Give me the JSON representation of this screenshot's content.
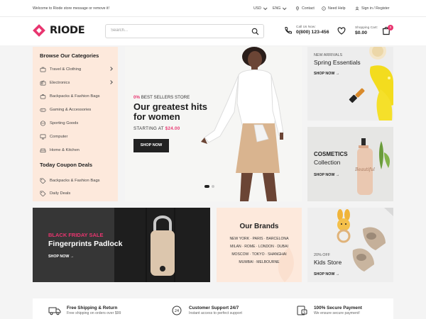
{
  "topbar": {
    "welcome": "Welcome to Riode store message or remove it!",
    "currency": "USD",
    "language": "ENG",
    "contact": "Contact",
    "help": "Need Help",
    "signin": "Sign in / Register"
  },
  "header": {
    "logo": "RIODE",
    "search_placeholder": "Search...",
    "call_label": "Call Us Now:",
    "phone": "0(800) 123-456",
    "cart_label": "Shopping Cart:",
    "cart_total": "$0.00",
    "cart_count": "0"
  },
  "sidebar": {
    "heading": "Browse Our Categories",
    "items": [
      {
        "label": "Travel & Clothing",
        "icon": "suitcase-icon",
        "has_arrow": true
      },
      {
        "label": "Electronics",
        "icon": "radio-icon",
        "has_arrow": true
      },
      {
        "label": "Backpacks & Fashion Bags",
        "icon": "bag-icon",
        "has_arrow": false
      },
      {
        "label": "Gaming & Accessories",
        "icon": "gamepad-icon",
        "has_arrow": false
      },
      {
        "label": "Sporting Goods",
        "icon": "ball-icon",
        "has_arrow": false
      },
      {
        "label": "Computer",
        "icon": "monitor-icon",
        "has_arrow": false
      },
      {
        "label": "Home & Kitchen",
        "icon": "sofa-icon",
        "has_arrow": false
      }
    ],
    "coupon_heading": "Today Coupon Deals",
    "coupon_items": [
      {
        "label": "Backpacks & Fashion Bags",
        "icon": "tag-icon"
      },
      {
        "label": "Daily Deals",
        "icon": "tag-icon"
      }
    ]
  },
  "hero": {
    "kicker_pct": "0%",
    "kicker_text": "BEST SELLERS STORE",
    "title": "Our greatest hits for women",
    "starting_text": "STARTING AT",
    "price": "$24.00",
    "button": "SHOP NOW",
    "slide_count": 2,
    "active_slide": 1
  },
  "promos": {
    "spring": {
      "small": "NEW ARRIVALS",
      "name": "Spring Essentials",
      "link": "SHOP NOW"
    },
    "cosmetics": {
      "name_bold": "COSMETICS",
      "name": "Collection",
      "link": "SHOP NOW"
    },
    "kids": {
      "small": "20% OFF",
      "name": "Kids Store",
      "link": "SHOP NOW"
    }
  },
  "black_friday": {
    "kicker": "BLACK FRIDAY SALE",
    "title": "Fingerprints Padlock",
    "link": "SHOP NOW"
  },
  "brands": {
    "title": "Our Brands",
    "rows": [
      "NEW YORK · PARIS · BARCELONA",
      "MILAN · ROME · LONDON · DUBAI",
      "MOSCOW · TOKYO · SHANGHAI",
      "MUMBAI · MELBOURNE"
    ]
  },
  "features": [
    {
      "title": "Free Shipping & Return",
      "subtitle": "Free shipping on orders over $99",
      "icon": "truck-icon"
    },
    {
      "title": "Customer Support 24/7",
      "subtitle": "Instant access to perfect support",
      "icon": "support-24-icon"
    },
    {
      "title": "100% Secure Payment",
      "subtitle": "We ensure secure payment!",
      "icon": "secure-payment-icon"
    }
  ],
  "colors": {
    "accent": "#e8356f",
    "peach": "#fde9dc",
    "dark": "#222222"
  }
}
